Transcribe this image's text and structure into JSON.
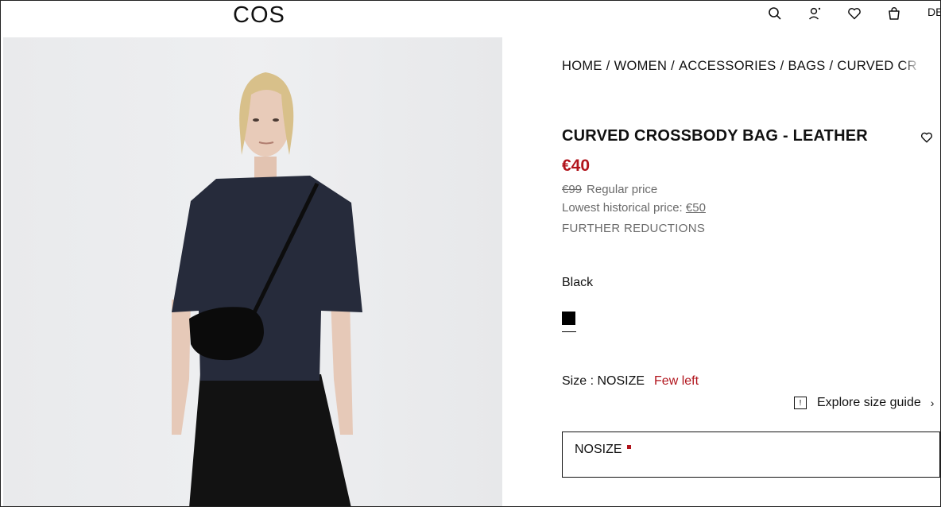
{
  "header": {
    "logo": "COS",
    "language": "DE",
    "icons": [
      "search-icon",
      "account-icon",
      "wishlist-icon",
      "bag-icon"
    ]
  },
  "breadcrumb": [
    "HOME",
    "WOMEN",
    "ACCESSORIES",
    "BAGS",
    "CURVED CR"
  ],
  "product": {
    "title": "CURVED CROSSBODY BAG - LEATHER",
    "price": "€40",
    "old_price": "€99",
    "regular_label": "Regular price",
    "lowest_label": "Lowest historical price:",
    "lowest_value": "€50",
    "further": "FURTHER REDUCTIONS",
    "color_name": "Black",
    "size_label": "Size : NOSIZE",
    "stock": "Few left",
    "size_guide": "Explore size guide",
    "selected_size": "NOSIZE"
  },
  "colors": {
    "sale": "#b1141c",
    "muted": "#6b6b6b",
    "swatch": "#000000"
  }
}
